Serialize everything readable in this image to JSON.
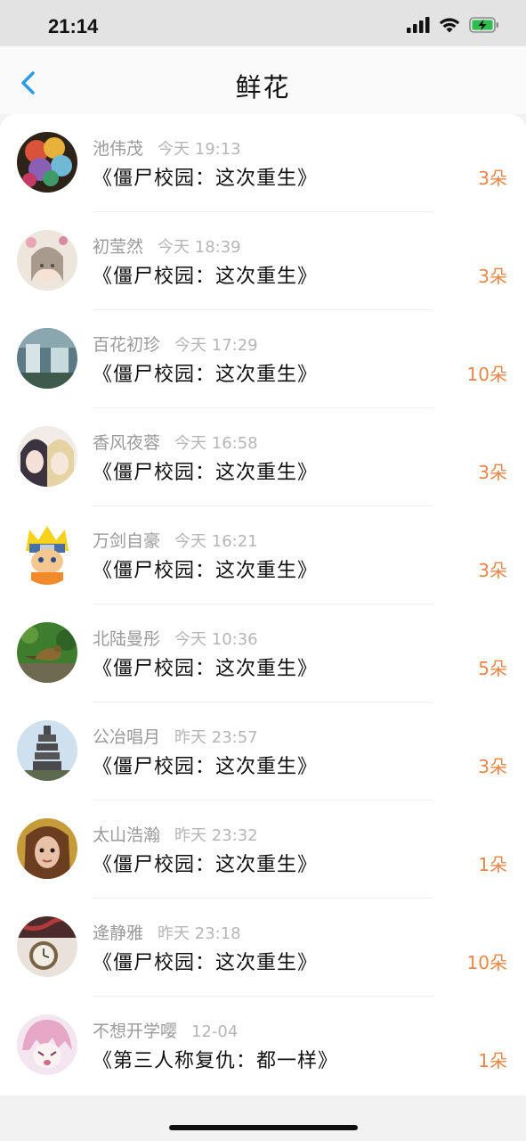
{
  "status_bar": {
    "time": "21:14",
    "icons": [
      "signal-icon",
      "wifi-icon",
      "battery-charging-icon"
    ],
    "battery_color": "#2dbe4c"
  },
  "header": {
    "title": "鲜花",
    "back_icon": "chevron-left-icon",
    "accent_color": "#2f9be6"
  },
  "count_color": "#e8864a",
  "rows": [
    {
      "name": "池伟茂",
      "time": "今天 19:13",
      "book": "《僵尸校园：这次重生》",
      "count": "3朵",
      "avatar": "balloons-avatar"
    },
    {
      "name": "初莹然",
      "time": "今天 18:39",
      "book": "《僵尸校园：这次重生》",
      "count": "3朵",
      "avatar": "anime-girl-avatar"
    },
    {
      "name": "百花初珍",
      "time": "今天 17:29",
      "book": "《僵尸校园：这次重生》",
      "count": "10朵",
      "avatar": "waterfall-avatar"
    },
    {
      "name": "香风夜蓉",
      "time": "今天 16:58",
      "book": "《僵尸校园：这次重生》",
      "count": "3朵",
      "avatar": "anime-couple-avatar"
    },
    {
      "name": "万剑自豪",
      "time": "今天 16:21",
      "book": "《僵尸校园：这次重生》",
      "count": "3朵",
      "avatar": "ninja-cartoon-avatar"
    },
    {
      "name": "北陆曼彤",
      "time": "今天 10:36",
      "book": "《僵尸校园：这次重生》",
      "count": "5朵",
      "avatar": "bird-avatar"
    },
    {
      "name": "公冶唱月",
      "time": "昨天 23:57",
      "book": "《僵尸校园：这次重生》",
      "count": "3朵",
      "avatar": "pagoda-avatar"
    },
    {
      "name": "太山浩瀚",
      "time": "昨天 23:32",
      "book": "《僵尸校园：这次重生》",
      "count": "1朵",
      "avatar": "girl-photo-avatar"
    },
    {
      "name": "逄静雅",
      "time": "昨天 23:18",
      "book": "《僵尸校园：这次重生》",
      "count": "10朵",
      "avatar": "pocket-watch-avatar"
    },
    {
      "name": "不想开学嘤",
      "time": "12-04",
      "book": "《第三人称复仇：都一样》",
      "count": "1朵",
      "avatar": "crying-anime-avatar"
    }
  ]
}
